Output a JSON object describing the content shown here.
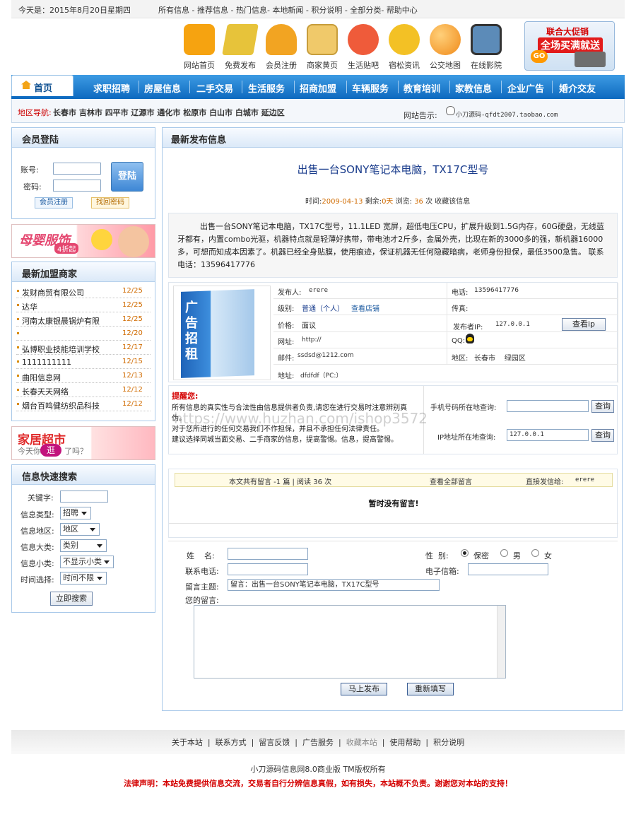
{
  "topbar": {
    "date": "今天是：2015年8月20日星期四",
    "links": [
      "所有信息",
      "推荐信息",
      "热门信息",
      "本地新闻",
      "积分说明",
      "全部分类",
      "帮助中心"
    ]
  },
  "icons": [
    {
      "label": "网站首页",
      "icon": "building-icon",
      "color": "#f6a310"
    },
    {
      "label": "免费发布",
      "icon": "pencil-icon",
      "color": "#e7c33a"
    },
    {
      "label": "会员注册",
      "icon": "person-icon",
      "color": "#f2a422"
    },
    {
      "label": "商家黄页",
      "icon": "calendar-icon",
      "color": "#f0c96a"
    },
    {
      "label": "生活贴吧",
      "icon": "thumbtack-icon",
      "color": "#ef5b3a"
    },
    {
      "label": "宿松资讯",
      "icon": "piggy-bank-icon",
      "color": "#f3c125"
    },
    {
      "label": "公交地图",
      "icon": "globe-icon",
      "color": "#f08a19"
    },
    {
      "label": "在线影院",
      "icon": "tv-icon",
      "color": "#5c8bb8"
    }
  ],
  "promo": {
    "line1": "联合大促销",
    "line2": "全场买满就送",
    "go": "GO"
  },
  "nav": {
    "home": "首页",
    "items": [
      "求职招聘",
      "房屋信息",
      "二手交易",
      "生活服务",
      "招商加盟",
      "车辆服务",
      "教育培训",
      "家教信息",
      "企业广告",
      "婚介交友"
    ]
  },
  "subnav": {
    "label": "地区导航:",
    "cities": [
      "长春市",
      "吉林市",
      "四平市",
      "辽源市",
      "通化市",
      "松原市",
      "白山市",
      "白城市",
      "延边区"
    ],
    "tip_label": "网站告示:",
    "tip_text": "小刀源码-qfdt2007.taobao.com"
  },
  "login": {
    "title": "会员登陆",
    "account_label": "账号:",
    "password_label": "密码:",
    "login_button": "登陆",
    "register": "会员注册",
    "forgot": "找回密码"
  },
  "banner1": {
    "text": "母婴服饰",
    "badge": "4折起"
  },
  "merchants": {
    "title": "最新加盟商家",
    "items": [
      {
        "name": "发财商贸有限公司",
        "date": "12/25"
      },
      {
        "name": "达华",
        "date": "12/25"
      },
      {
        "name": "河南太康银晨锅炉有限",
        "date": "12/25"
      },
      {
        "name": "",
        "date": "12/20"
      },
      {
        "name": "弘博职业技能培训学校",
        "date": "12/17"
      },
      {
        "name": "1111111111",
        "date": "12/15"
      },
      {
        "name": "曲阳信息网",
        "date": "12/13"
      },
      {
        "name": "长春天天网络",
        "date": "12/12"
      },
      {
        "name": "烟台百鸣健纺织品科技",
        "date": "12/12"
      }
    ]
  },
  "banner2": {
    "text": "家居超市",
    "sub1": "今天你",
    "badge": "逛",
    "sub2": "了吗？"
  },
  "quicksearch": {
    "title": "信息快速搜索",
    "keyword_label": "关键字:",
    "type_label": "信息类型:",
    "type_value": "招聘",
    "area_label": "信息地区:",
    "area_value": "地区",
    "bigcat_label": "信息大类:",
    "bigcat_value": "类别",
    "smallcat_label": "信息小类:",
    "smallcat_value": "不显示小类",
    "time_label": "时间选择:",
    "time_value": "时间不限",
    "search_button": "立即搜索"
  },
  "main": {
    "section_title": "最新发布信息",
    "title": "出售一台SONY笔记本电脑，TX17C型号",
    "meta_time_label": "时间:",
    "meta_time": "2009-04-13",
    "meta_left_label": "剩余:",
    "meta_left": "0天",
    "meta_views_label": "浏览:",
    "meta_views": "36",
    "meta_views_unit": "次",
    "meta_fav": "收藏该信息",
    "body": "出售一台SONY笔记本电脑，TX17C型号，11.1LED 宽屏，超低电压CPU，扩展升级到1.5G内存，60G硬盘，无线蓝牙都有，内置combo光驱，机器特点就是轻薄好携带，带电池才2斤多，金属外壳，比现在新的3000多的强，新机器16000多，可想而知成本因素了。机器已经全身贴膜，使用痕迹，保证机器无任何隐藏暗病，老师身份担保，最低3500急售。   联系电话：13596417776",
    "ad_image_text": "广告招租"
  },
  "details": {
    "publisher_label": "发布人:",
    "publisher": "erere",
    "phone_label": "电话:",
    "phone": "13596417776",
    "level_label": "级别:",
    "level": "普通（个人）",
    "shop_link": "查看店铺",
    "fax_label": "传真:",
    "fax": "",
    "price_label": "价格:",
    "price": "面议",
    "ip_label": "发布者IP:",
    "ip": "127.0.0.1",
    "ip_button": "查看ip",
    "url_label": "网址:",
    "url": "http://",
    "qq_label": "QQ:",
    "email_label": "邮件:",
    "email": "ssdsd@1212.com",
    "region_label": "地区:",
    "region": "长春市    绿园区",
    "address_label": "地址:",
    "address": "dfdfdf（PC:）"
  },
  "notice": {
    "title": "提醒您:",
    "lines": [
      "所有信息的真实性与合法性由信息提供者负责,请您在进行交易时注意辨别真伪。",
      "对于您所进行的任何交易我们不作担保，并且不承担任何法律责任。",
      "建议选择同城当面交易、二手商家的信息，提高警惕。信息，提高警惕。"
    ],
    "phone_query_label": "手机号码所在地查询:",
    "ip_query_label": "IP地址所在地查询:",
    "ip_query_value": "127.0.0.1",
    "query_button": "查询"
  },
  "watermark": "https://www.huzhan.com/ishop3572",
  "comments": {
    "summary": "本文共有留言 -1 篇 | 阅读 36 次",
    "view_all": "查看全部留言",
    "direct_label": "直接发信给:",
    "direct_to": "erere",
    "empty": "暂时没有留言!"
  },
  "form": {
    "name_label": "姓    名:",
    "gender_label": "性  别:",
    "genders": [
      "保密",
      "男",
      "女"
    ],
    "phone_label": "联系电话:",
    "email_label": "电子信箱:",
    "subject_label": "留言主题:",
    "subject_value": "留言：出售一台SONY笔记本电脑，TX17C型号",
    "message_label": "您的留言:",
    "submit": "马上发布",
    "reset": "重新填写"
  },
  "footer": {
    "links": [
      "关于本站",
      "联系方式",
      "留言反馈",
      "广告服务",
      "收藏本站",
      "使用帮助",
      "积分说明"
    ],
    "copyright": "小刀源码信息网8.0商业版 TM版权所有",
    "legal": "法律声明：本站免费提供信息交流，交易者自行分辨信息真假，如有损失，本站概不负责。谢谢您对本站的支持！"
  },
  "colors": {
    "nav": "#0d69bf",
    "accent_red": "#d40000",
    "date_orange": "#d06b00",
    "border_blue": "#a9c9e9"
  }
}
